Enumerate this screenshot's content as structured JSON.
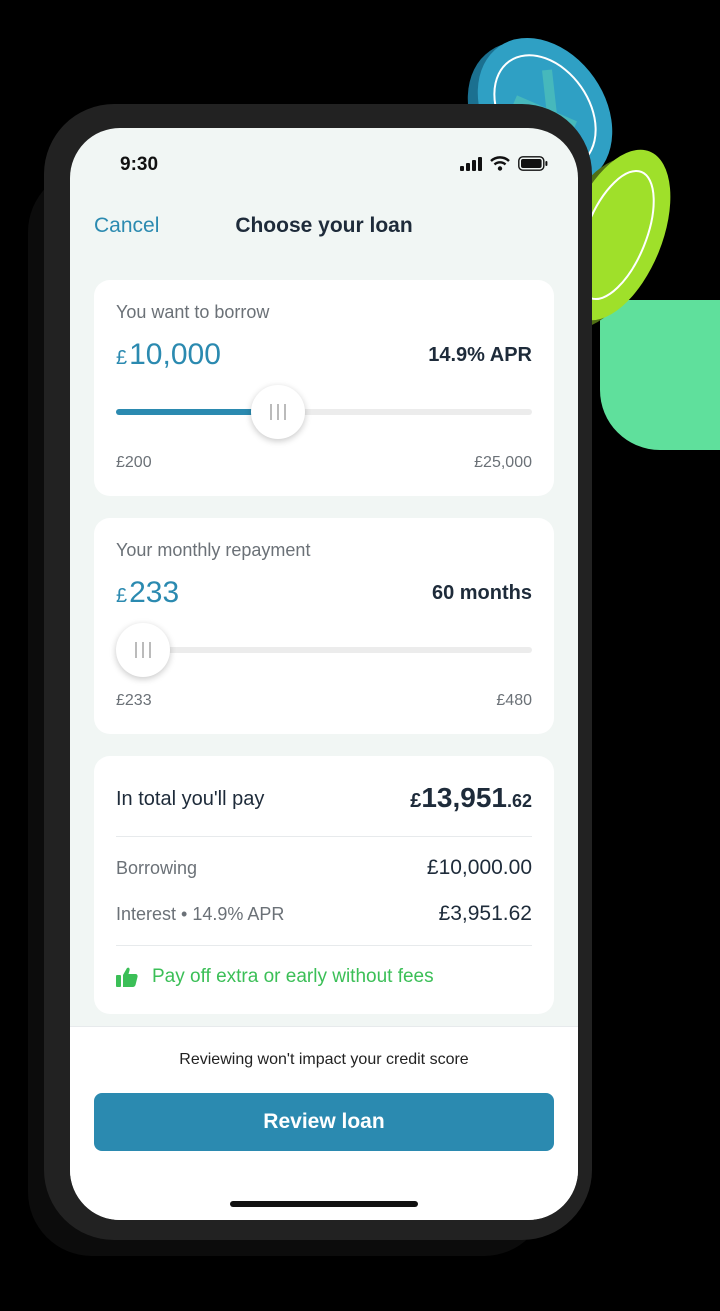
{
  "status_bar": {
    "time": "9:30"
  },
  "nav": {
    "cancel_label": "Cancel",
    "title": "Choose your loan"
  },
  "borrow": {
    "label": "You want to borrow",
    "currency": "£",
    "amount": "10,000",
    "apr": "14.9% APR",
    "slider_min": "£200",
    "slider_max": "£25,000",
    "slider_position": 0.39
  },
  "repayment": {
    "label": "Your monthly repayment",
    "currency": "£",
    "amount": "233",
    "term": "60 months",
    "slider_min": "£233",
    "slider_max": "£480",
    "slider_position": 0.0
  },
  "total": {
    "label": "In total you'll pay",
    "currency": "£",
    "whole": "13,951",
    "pence": ".62",
    "borrowing_label": "Borrowing",
    "borrowing_value": "£10,000.00",
    "interest_label": "Interest • 14.9% APR",
    "interest_value": "£3,951.62",
    "fee_note": "Pay off extra or early without fees"
  },
  "footer": {
    "note": "Reviewing won't impact your credit score",
    "cta_label": "Review loan"
  },
  "colors": {
    "accent": "#2b8ab0",
    "positive": "#3bbf57",
    "background": "#f1f6f4",
    "coin_blue": "#2fa0c4",
    "coin_green": "#9fe02a"
  },
  "icons": [
    "signal-icon",
    "wifi-icon",
    "battery-icon",
    "thumbs-up-icon",
    "slider-grip-icon"
  ]
}
